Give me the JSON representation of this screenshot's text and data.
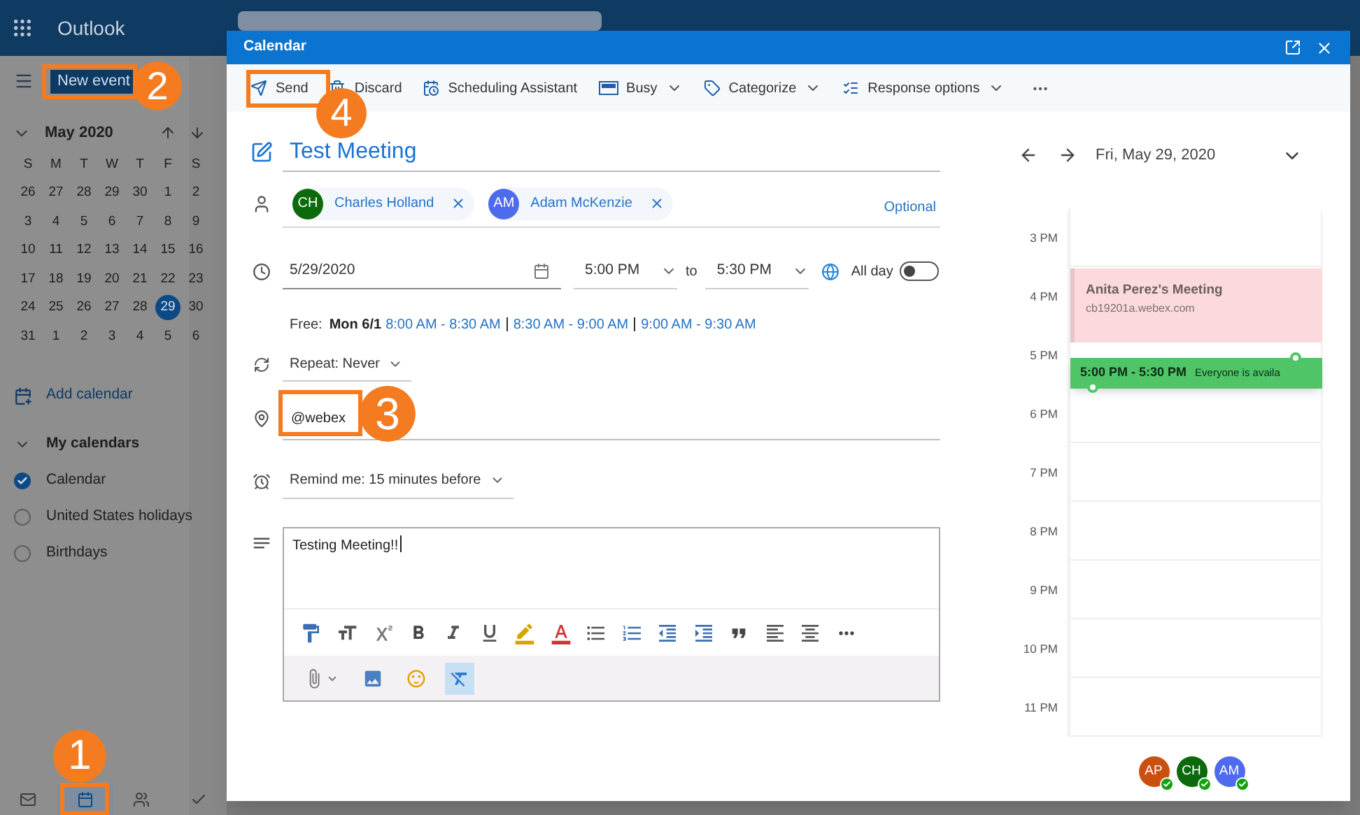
{
  "app": {
    "name": "Outlook",
    "new_event": "New event",
    "month": "May 2020",
    "weekdays": [
      "S",
      "M",
      "T",
      "W",
      "T",
      "F",
      "S"
    ],
    "weeks": [
      [
        {
          "day": "26",
          "selected": false
        },
        {
          "day": "27",
          "selected": false
        },
        {
          "day": "28",
          "selected": false
        },
        {
          "day": "29",
          "selected": false
        },
        {
          "day": "30",
          "selected": false
        },
        {
          "day": "1",
          "selected": false
        },
        {
          "day": "2",
          "selected": false
        }
      ],
      [
        {
          "day": "3",
          "selected": false
        },
        {
          "day": "4",
          "selected": false
        },
        {
          "day": "5",
          "selected": false
        },
        {
          "day": "6",
          "selected": false
        },
        {
          "day": "7",
          "selected": false
        },
        {
          "day": "8",
          "selected": false
        },
        {
          "day": "9",
          "selected": false
        }
      ],
      [
        {
          "day": "10",
          "selected": false
        },
        {
          "day": "11",
          "selected": false
        },
        {
          "day": "12",
          "selected": false
        },
        {
          "day": "13",
          "selected": false
        },
        {
          "day": "14",
          "selected": false
        },
        {
          "day": "15",
          "selected": false
        },
        {
          "day": "16",
          "selected": false
        }
      ],
      [
        {
          "day": "17",
          "selected": false
        },
        {
          "day": "18",
          "selected": false
        },
        {
          "day": "19",
          "selected": false
        },
        {
          "day": "20",
          "selected": false
        },
        {
          "day": "21",
          "selected": false
        },
        {
          "day": "22",
          "selected": false
        },
        {
          "day": "23",
          "selected": false
        }
      ],
      [
        {
          "day": "24",
          "selected": false
        },
        {
          "day": "25",
          "selected": false
        },
        {
          "day": "26",
          "selected": false
        },
        {
          "day": "27",
          "selected": false
        },
        {
          "day": "28",
          "selected": false
        },
        {
          "day": "29",
          "selected": true
        },
        {
          "day": "30",
          "selected": false
        }
      ],
      [
        {
          "day": "31",
          "selected": false
        },
        {
          "day": "1",
          "selected": false
        },
        {
          "day": "2",
          "selected": false
        },
        {
          "day": "3",
          "selected": false
        },
        {
          "day": "4",
          "selected": false
        },
        {
          "day": "5",
          "selected": false
        },
        {
          "day": "6",
          "selected": false
        }
      ]
    ],
    "add_calendar": "Add calendar",
    "my_calendars": "My calendars",
    "calendars": [
      {
        "name": "Calendar",
        "checked": true
      },
      {
        "name": "United States holidays",
        "checked": false
      },
      {
        "name": "Birthdays",
        "checked": false
      }
    ],
    "nav": [
      {
        "kind": "mail",
        "selected": false
      },
      {
        "kind": "calendar",
        "selected": true
      },
      {
        "kind": "people",
        "selected": false
      },
      {
        "kind": "tasks",
        "selected": false
      }
    ]
  },
  "dialog": {
    "title": "Calendar",
    "toolbar": [
      {
        "kind": "send",
        "label": "Send",
        "dropdown": false
      },
      {
        "kind": "discard",
        "label": "Discard",
        "dropdown": false
      },
      {
        "kind": "scheduling",
        "label": "Scheduling Assistant",
        "dropdown": false
      },
      {
        "kind": "busy",
        "label": "Busy",
        "dropdown": true
      },
      {
        "kind": "categorize",
        "label": "Categorize",
        "dropdown": true
      },
      {
        "kind": "response",
        "label": "Response options",
        "dropdown": true
      }
    ],
    "event": {
      "title": "Test Meeting",
      "attendees": [
        {
          "initials": "CH",
          "name": "Charles Holland",
          "color": "#0b6a0b"
        },
        {
          "initials": "AM",
          "name": "Adam McKenzie",
          "color": "#4f6bed"
        }
      ],
      "optional": "Optional",
      "date": "5/29/2020",
      "start": "5:00 PM",
      "to": "to",
      "end": "5:30 PM",
      "all_day_label": "All day",
      "all_day": false,
      "free_label": "Free:",
      "free_day": "Mon 6/1",
      "free_slots": [
        "8:00 AM - 8:30 AM",
        "8:30 AM - 9:00 AM",
        "9:00 AM - 9:30 AM"
      ],
      "repeat": "Repeat: Never",
      "location": "@webex",
      "reminder": "Remind me: 15 minutes before",
      "body": "Testing Meeting!!",
      "format_tools": [
        {
          "kind": "painter"
        },
        {
          "kind": "size"
        },
        {
          "kind": "superscript"
        },
        {
          "kind": "bold"
        },
        {
          "kind": "italic"
        },
        {
          "kind": "underline"
        },
        {
          "kind": "highlight"
        },
        {
          "kind": "color"
        },
        {
          "kind": "bullets"
        },
        {
          "kind": "numbering"
        },
        {
          "kind": "outdent"
        },
        {
          "kind": "indent"
        },
        {
          "kind": "quote"
        },
        {
          "kind": "left"
        },
        {
          "kind": "center"
        },
        {
          "kind": "more"
        }
      ],
      "insert_tools": [
        {
          "kind": "attach",
          "selected": false
        },
        {
          "kind": "image",
          "selected": false
        },
        {
          "kind": "emoji",
          "selected": false
        },
        {
          "kind": "clear",
          "selected": true
        }
      ]
    },
    "schedule": {
      "date": "Fri, May 29, 2020",
      "hours": [
        "3 PM",
        "4 PM",
        "5 PM",
        "6 PM",
        "7 PM",
        "8 PM",
        "9 PM",
        "10 PM",
        "11 PM"
      ],
      "events": [
        {
          "kind": "busy",
          "title": "Anita Perez's Meeting",
          "subtitle": "cb19201a.webex.com"
        },
        {
          "kind": "proposed",
          "title": "5:00 PM - 5:30 PM",
          "subtitle": "Everyone is availa"
        }
      ],
      "attendees": [
        {
          "initials": "AP",
          "color": "#ca5010"
        },
        {
          "initials": "CH",
          "color": "#0b6a0b"
        },
        {
          "initials": "AM",
          "color": "#4f6bed"
        }
      ]
    }
  },
  "annotations": [
    {
      "number": "1"
    },
    {
      "number": "2"
    },
    {
      "number": "3"
    },
    {
      "number": "4"
    }
  ]
}
